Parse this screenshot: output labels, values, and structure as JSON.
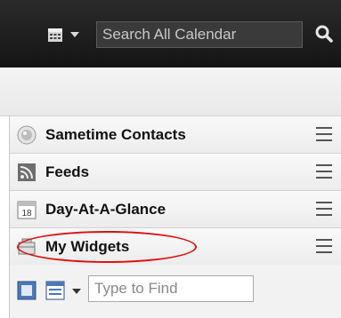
{
  "header": {
    "search_placeholder": "Search All Calendar",
    "calendar_icon": "calendar-icon",
    "search_icon": "magnifier-icon"
  },
  "sidebar": {
    "sections": [
      {
        "label": "Sametime Contacts",
        "icon": "sametime-icon"
      },
      {
        "label": "Feeds",
        "icon": "rss-feed-icon"
      },
      {
        "label": "Day-At-A-Glance",
        "icon": "day-calendar-icon",
        "icon_text": "18"
      },
      {
        "label": "My Widgets",
        "icon": "widgets-icon",
        "highlighted": true
      }
    ],
    "menu_icon": "hamburger-menu-icon"
  },
  "widgets_toolbar": {
    "find_placeholder": "Type to Find"
  },
  "colors": {
    "highlight": "#e01010",
    "topbar": "#1e1e1e"
  }
}
